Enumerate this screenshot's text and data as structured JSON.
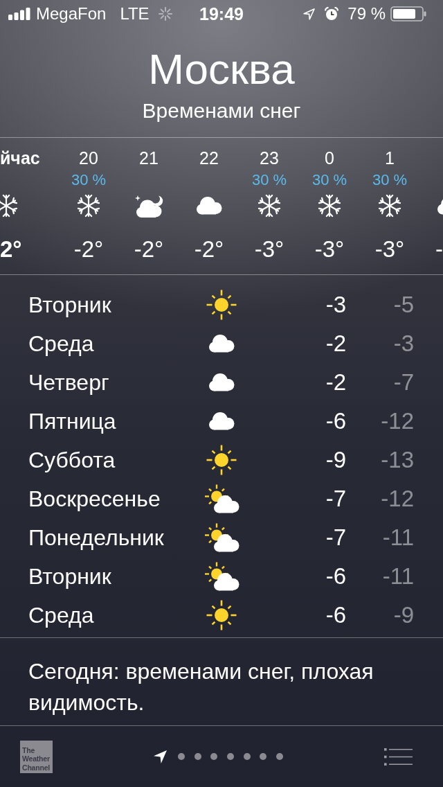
{
  "status_bar": {
    "carrier": "MegaFon",
    "network": "LTE",
    "time": "19:49",
    "battery": "79 %"
  },
  "location": {
    "city": "Москва",
    "condition": "Временами снег"
  },
  "hourly": [
    {
      "hour": "йчас",
      "kind": "snow",
      "temp": "2°",
      "now": true
    },
    {
      "hour": "20",
      "precip": "30 %",
      "kind": "snow",
      "temp": "-2°",
      "now": false
    },
    {
      "hour": "21",
      "kind": "moon_cloud",
      "temp": "-2°",
      "now": false
    },
    {
      "hour": "22",
      "kind": "cloud",
      "temp": "-2°",
      "now": false
    },
    {
      "hour": "23",
      "precip": "30 %",
      "kind": "snow",
      "temp": "-3°",
      "now": false
    },
    {
      "hour": "0",
      "precip": "30 %",
      "kind": "snow",
      "temp": "-3°",
      "now": false
    },
    {
      "hour": "1",
      "precip": "30 %",
      "kind": "snow",
      "temp": "-3°",
      "now": false
    },
    {
      "kind": "cloud",
      "temp": "-",
      "now": false
    }
  ],
  "daily": [
    {
      "day": "Вторник",
      "kind": "sun",
      "high": "-3",
      "low": "-5"
    },
    {
      "day": "Среда",
      "kind": "cloud",
      "high": "-2",
      "low": "-3"
    },
    {
      "day": "Четверг",
      "kind": "cloud",
      "high": "-2",
      "low": "-7"
    },
    {
      "day": "Пятница",
      "kind": "cloud",
      "high": "-6",
      "low": "-12"
    },
    {
      "day": "Суббота",
      "kind": "sun",
      "high": "-9",
      "low": "-13"
    },
    {
      "day": "Воскресенье",
      "kind": "sun_cloud",
      "high": "-7",
      "low": "-12"
    },
    {
      "day": "Понедельник",
      "kind": "sun_cloud",
      "high": "-7",
      "low": "-11"
    },
    {
      "day": "Вторник",
      "kind": "sun_cloud",
      "high": "-6",
      "low": "-11"
    },
    {
      "day": "Среда",
      "kind": "sun",
      "high": "-6",
      "low": "-9"
    }
  ],
  "summary": "Сегодня: временами снег, плохая видимость.",
  "footer": {
    "logo": "The Weather Channel",
    "pages": [
      {
        "kind": "location",
        "selected": true
      },
      {
        "kind": "dot",
        "selected": false
      },
      {
        "kind": "dot",
        "selected": false
      },
      {
        "kind": "dot",
        "selected": false
      },
      {
        "kind": "dot",
        "selected": false
      },
      {
        "kind": "dot",
        "selected": false
      },
      {
        "kind": "dot",
        "selected": false
      },
      {
        "kind": "dot",
        "selected": false
      }
    ]
  }
}
